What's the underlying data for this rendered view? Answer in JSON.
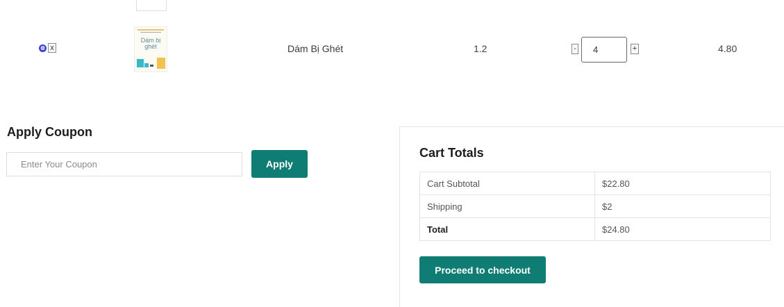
{
  "cart_item": {
    "remove_symbol": "⊗",
    "remove_x": "x",
    "thumbnail_title": "Dám bị ghét",
    "name": "Dám Bị Ghét",
    "price": "1.2",
    "qty_minus": "-",
    "quantity": "4",
    "qty_plus": "+",
    "subtotal": "4.80"
  },
  "coupon": {
    "title": "Apply Coupon",
    "placeholder": "Enter Your Coupon",
    "apply_label": "Apply"
  },
  "totals": {
    "title": "Cart Totals",
    "rows": [
      {
        "label": "Cart Subtotal",
        "value": "$22.80"
      },
      {
        "label": "Shipping",
        "value": "$2"
      },
      {
        "label": "Total",
        "value": "$24.80"
      }
    ],
    "checkout_label": "Proceed to checkout"
  },
  "colors": {
    "accent": "#0f7d74",
    "remove_icon": "#3b3bd6"
  }
}
